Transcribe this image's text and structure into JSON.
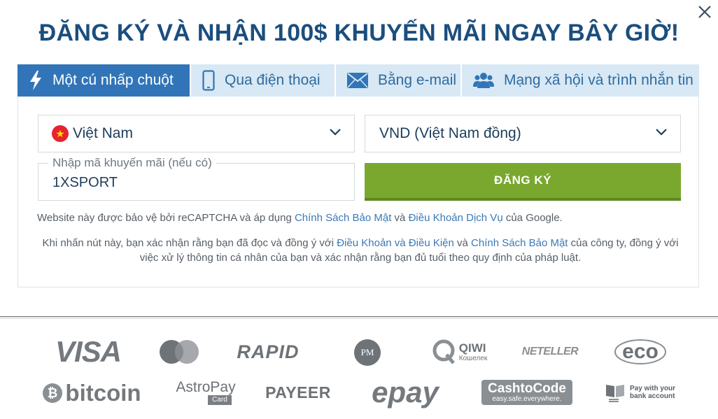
{
  "headline": "ĐĂNG KÝ VÀ NHẬN 100$ KHUYẾN MÃI NGAY BÂY GIỜ!",
  "tabs": [
    {
      "label": "Một cú nhấp chuột",
      "icon": "lightning-icon",
      "active": true
    },
    {
      "label": "Qua điện thoại",
      "icon": "phone-icon",
      "active": false
    },
    {
      "label": "Bằng e-mail",
      "icon": "envelope-icon",
      "active": false
    },
    {
      "label": "Mạng xã hội và trình nhắn tin",
      "icon": "users-icon",
      "active": false
    }
  ],
  "form": {
    "country_value": "Việt Nam",
    "currency_value": "VND (Việt Nam đồng)",
    "promo_label": "Nhập mã khuyến mãi (nếu có)",
    "promo_value": "1XSPORT",
    "register_label": "ĐĂNG KÝ"
  },
  "legal": {
    "recaptcha_prefix": "Website này được bảo vệ bởi reCAPTCHA và áp dụng ",
    "recaptcha_link1": "Chính Sách Bảo Mật",
    "recaptcha_mid": " và ",
    "recaptcha_link2": "Điều Khoản Dịch Vụ",
    "recaptcha_suffix": " của Google.",
    "consent_prefix": "Khi nhấn nút này, bạn xác nhận rằng bạn đã đọc và đồng ý với ",
    "consent_link1": "Điều Khoản và Điều Kiện",
    "consent_mid": " và ",
    "consent_link2": "Chính Sách Bảo Mật",
    "consent_suffix": " của công ty, đồng ý với việc xử lý thông tin cá nhân của bạn và xác nhận rằng bạn đủ tuổi theo quy định của pháp luật."
  },
  "payments": {
    "visa": "VISA",
    "rapid": "RAPID",
    "pm": "PM",
    "qiwi": "QIWI",
    "qiwi_sub": "Кошелек",
    "neteller": "NETELLER",
    "eco": "eco",
    "bitcoin": "bitcoin",
    "astropay": "AstroPay",
    "astropay_sub": "Card",
    "payeer": "PAYEER",
    "epay": "epay",
    "cashtocode": "CashtoCode",
    "cashtocode_sub": "easy.safe.everywhere.",
    "bank": "Pay with your bank account"
  },
  "colors": {
    "headline": "#1b4e7e",
    "tab_active": "#3175b8",
    "tab_inactive": "#d8e8f4",
    "register_button": "#7aa82f",
    "link": "#3b79b6"
  }
}
